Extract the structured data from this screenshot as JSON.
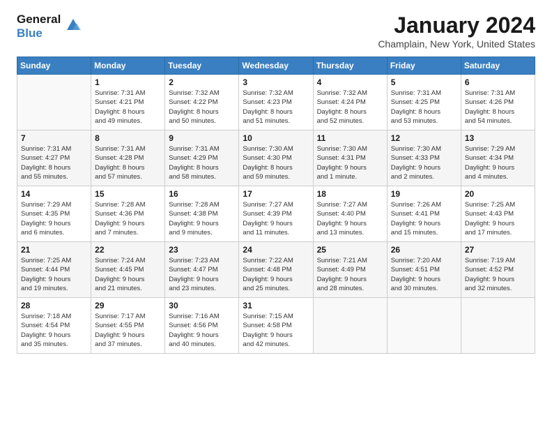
{
  "header": {
    "logo_line1": "General",
    "logo_line2": "Blue",
    "month_year": "January 2024",
    "location": "Champlain, New York, United States"
  },
  "weekdays": [
    "Sunday",
    "Monday",
    "Tuesday",
    "Wednesday",
    "Thursday",
    "Friday",
    "Saturday"
  ],
  "weeks": [
    [
      {
        "day": "",
        "info": ""
      },
      {
        "day": "1",
        "info": "Sunrise: 7:31 AM\nSunset: 4:21 PM\nDaylight: 8 hours\nand 49 minutes."
      },
      {
        "day": "2",
        "info": "Sunrise: 7:32 AM\nSunset: 4:22 PM\nDaylight: 8 hours\nand 50 minutes."
      },
      {
        "day": "3",
        "info": "Sunrise: 7:32 AM\nSunset: 4:23 PM\nDaylight: 8 hours\nand 51 minutes."
      },
      {
        "day": "4",
        "info": "Sunrise: 7:32 AM\nSunset: 4:24 PM\nDaylight: 8 hours\nand 52 minutes."
      },
      {
        "day": "5",
        "info": "Sunrise: 7:31 AM\nSunset: 4:25 PM\nDaylight: 8 hours\nand 53 minutes."
      },
      {
        "day": "6",
        "info": "Sunrise: 7:31 AM\nSunset: 4:26 PM\nDaylight: 8 hours\nand 54 minutes."
      }
    ],
    [
      {
        "day": "7",
        "info": "Sunrise: 7:31 AM\nSunset: 4:27 PM\nDaylight: 8 hours\nand 55 minutes."
      },
      {
        "day": "8",
        "info": "Sunrise: 7:31 AM\nSunset: 4:28 PM\nDaylight: 8 hours\nand 57 minutes."
      },
      {
        "day": "9",
        "info": "Sunrise: 7:31 AM\nSunset: 4:29 PM\nDaylight: 8 hours\nand 58 minutes."
      },
      {
        "day": "10",
        "info": "Sunrise: 7:30 AM\nSunset: 4:30 PM\nDaylight: 8 hours\nand 59 minutes."
      },
      {
        "day": "11",
        "info": "Sunrise: 7:30 AM\nSunset: 4:31 PM\nDaylight: 9 hours\nand 1 minute."
      },
      {
        "day": "12",
        "info": "Sunrise: 7:30 AM\nSunset: 4:33 PM\nDaylight: 9 hours\nand 2 minutes."
      },
      {
        "day": "13",
        "info": "Sunrise: 7:29 AM\nSunset: 4:34 PM\nDaylight: 9 hours\nand 4 minutes."
      }
    ],
    [
      {
        "day": "14",
        "info": "Sunrise: 7:29 AM\nSunset: 4:35 PM\nDaylight: 9 hours\nand 6 minutes."
      },
      {
        "day": "15",
        "info": "Sunrise: 7:28 AM\nSunset: 4:36 PM\nDaylight: 9 hours\nand 7 minutes."
      },
      {
        "day": "16",
        "info": "Sunrise: 7:28 AM\nSunset: 4:38 PM\nDaylight: 9 hours\nand 9 minutes."
      },
      {
        "day": "17",
        "info": "Sunrise: 7:27 AM\nSunset: 4:39 PM\nDaylight: 9 hours\nand 11 minutes."
      },
      {
        "day": "18",
        "info": "Sunrise: 7:27 AM\nSunset: 4:40 PM\nDaylight: 9 hours\nand 13 minutes."
      },
      {
        "day": "19",
        "info": "Sunrise: 7:26 AM\nSunset: 4:41 PM\nDaylight: 9 hours\nand 15 minutes."
      },
      {
        "day": "20",
        "info": "Sunrise: 7:25 AM\nSunset: 4:43 PM\nDaylight: 9 hours\nand 17 minutes."
      }
    ],
    [
      {
        "day": "21",
        "info": "Sunrise: 7:25 AM\nSunset: 4:44 PM\nDaylight: 9 hours\nand 19 minutes."
      },
      {
        "day": "22",
        "info": "Sunrise: 7:24 AM\nSunset: 4:45 PM\nDaylight: 9 hours\nand 21 minutes."
      },
      {
        "day": "23",
        "info": "Sunrise: 7:23 AM\nSunset: 4:47 PM\nDaylight: 9 hours\nand 23 minutes."
      },
      {
        "day": "24",
        "info": "Sunrise: 7:22 AM\nSunset: 4:48 PM\nDaylight: 9 hours\nand 25 minutes."
      },
      {
        "day": "25",
        "info": "Sunrise: 7:21 AM\nSunset: 4:49 PM\nDaylight: 9 hours\nand 28 minutes."
      },
      {
        "day": "26",
        "info": "Sunrise: 7:20 AM\nSunset: 4:51 PM\nDaylight: 9 hours\nand 30 minutes."
      },
      {
        "day": "27",
        "info": "Sunrise: 7:19 AM\nSunset: 4:52 PM\nDaylight: 9 hours\nand 32 minutes."
      }
    ],
    [
      {
        "day": "28",
        "info": "Sunrise: 7:18 AM\nSunset: 4:54 PM\nDaylight: 9 hours\nand 35 minutes."
      },
      {
        "day": "29",
        "info": "Sunrise: 7:17 AM\nSunset: 4:55 PM\nDaylight: 9 hours\nand 37 minutes."
      },
      {
        "day": "30",
        "info": "Sunrise: 7:16 AM\nSunset: 4:56 PM\nDaylight: 9 hours\nand 40 minutes."
      },
      {
        "day": "31",
        "info": "Sunrise: 7:15 AM\nSunset: 4:58 PM\nDaylight: 9 hours\nand 42 minutes."
      },
      {
        "day": "",
        "info": ""
      },
      {
        "day": "",
        "info": ""
      },
      {
        "day": "",
        "info": ""
      }
    ]
  ]
}
